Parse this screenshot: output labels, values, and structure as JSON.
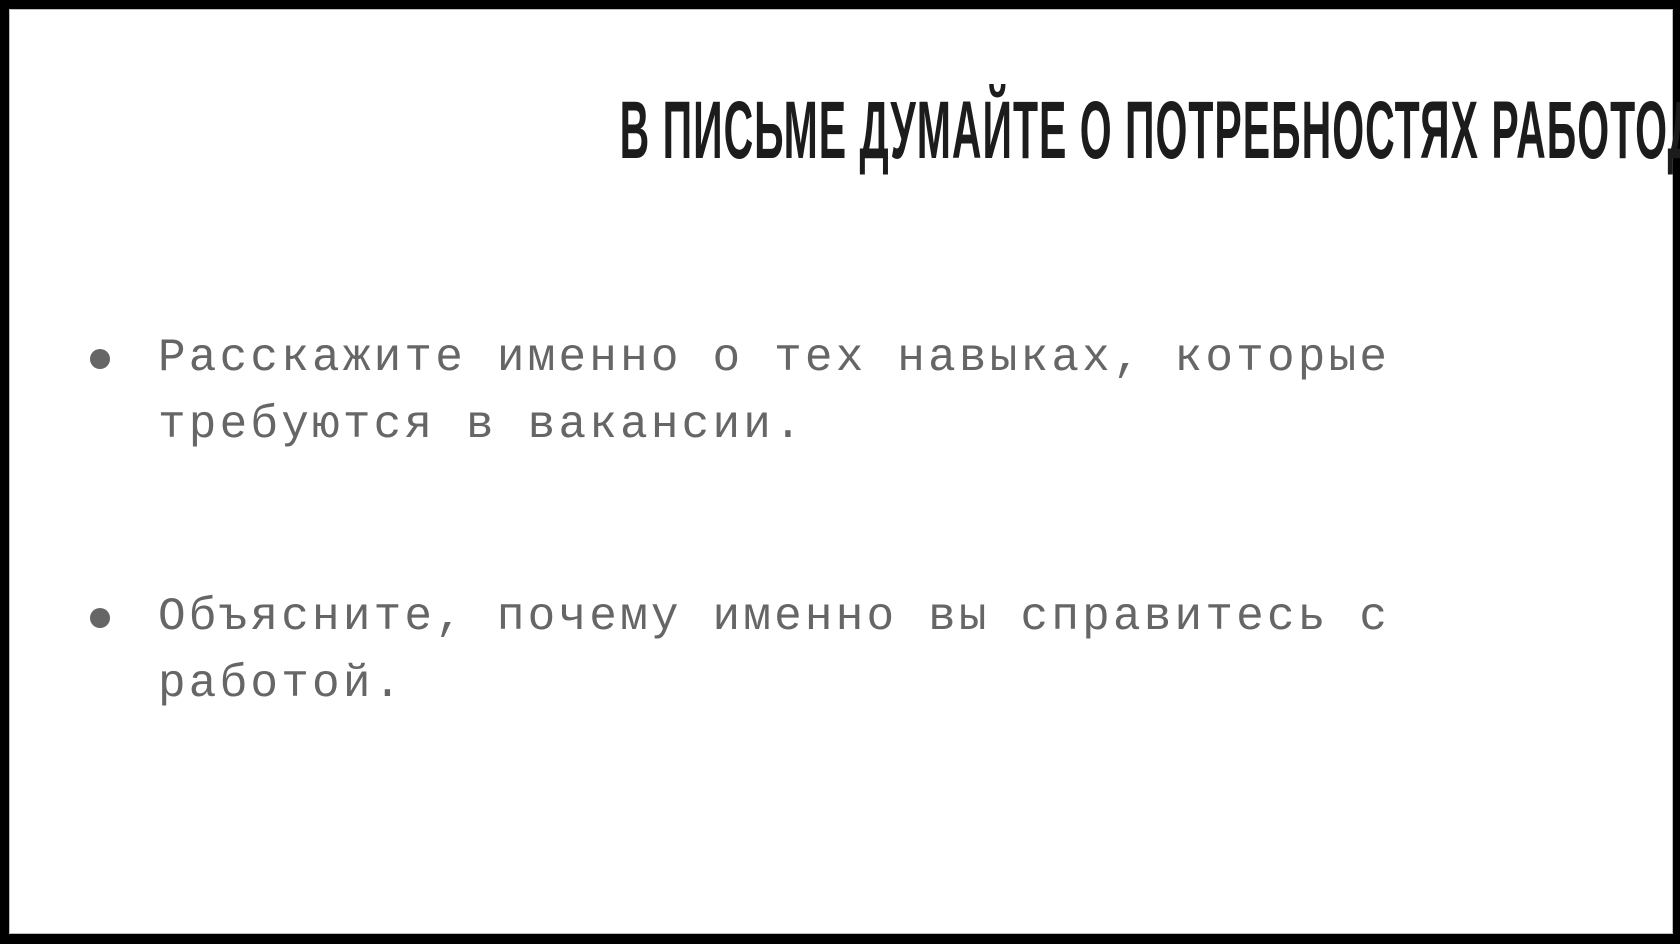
{
  "slide": {
    "title": "В письме думайте о потребностях работодателя",
    "bullets": [
      {
        "icon": "bullet-dot-icon",
        "text_lines": [
          "Расскажите именно о тех навыках, которые",
          "требуются в вакансии."
        ]
      },
      {
        "icon": "bullet-dot-icon",
        "text_lines": [
          "Объясните, почему именно вы справитесь с работой."
        ]
      }
    ]
  },
  "colors": {
    "frame": "#000000",
    "background": "#ffffff",
    "title": "#1c1c1c",
    "body_text": "#666666"
  }
}
